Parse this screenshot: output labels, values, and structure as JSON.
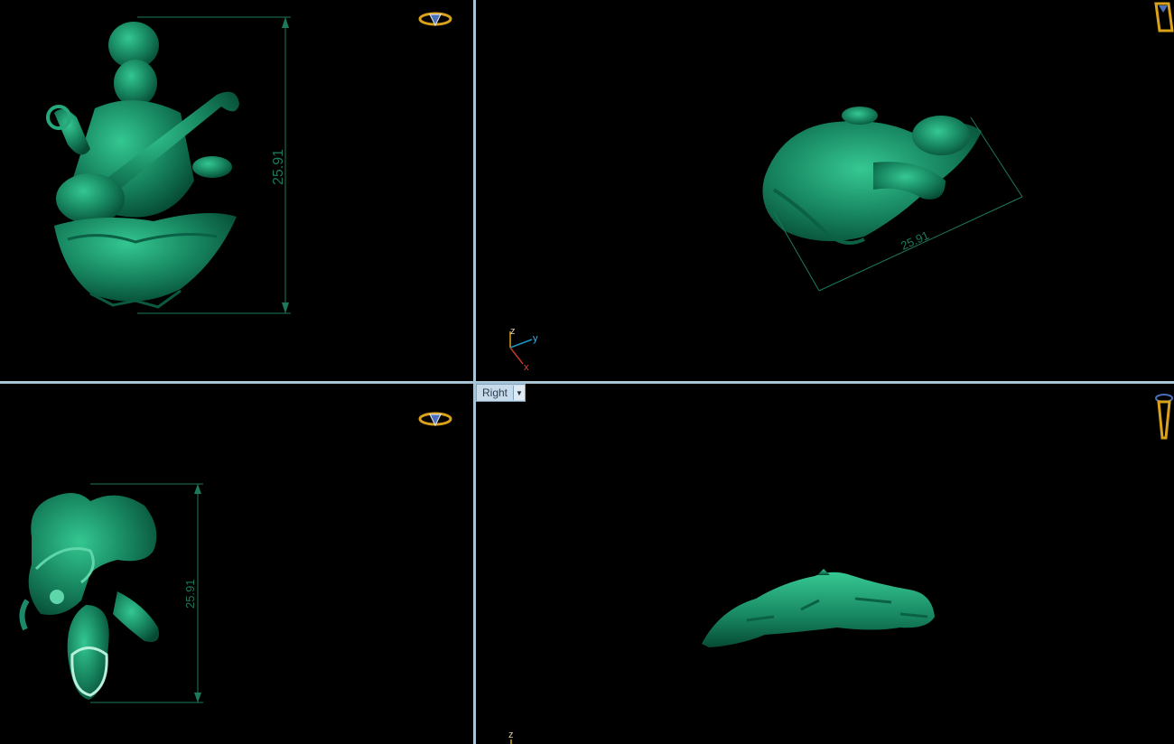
{
  "viewports": {
    "front": {
      "dimension": "25.91"
    },
    "perspective": {
      "dimension": "25.91",
      "axes": {
        "z": "z",
        "y": "y",
        "x": "x"
      }
    },
    "top": {
      "dimension": "25.91"
    },
    "right": {
      "label": "Right",
      "axes": {
        "z": "z"
      }
    }
  },
  "colors": {
    "model": "#1c8a68",
    "model_highlight": "#5fd6aa",
    "dimension_line": "#1d7a58",
    "divider": "#a9c4d6",
    "gizmo": "#d9a21a"
  },
  "icons": [
    "view-cube-gizmo-icon",
    "chevron-down-icon"
  ]
}
